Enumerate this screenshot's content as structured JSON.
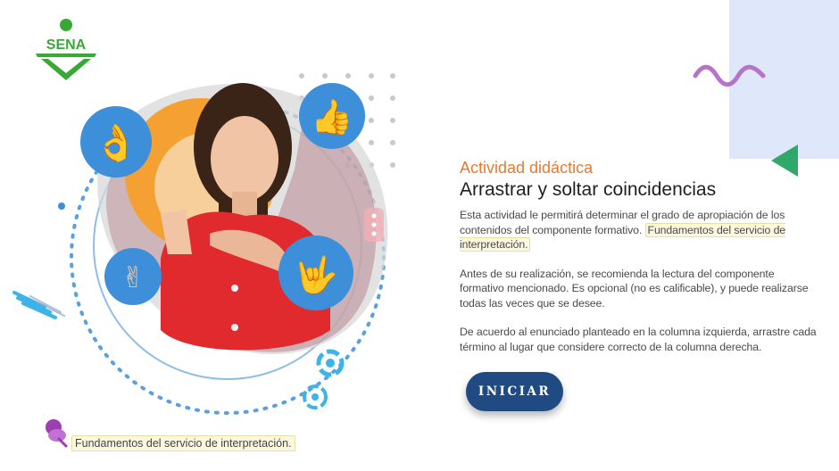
{
  "brand": {
    "logo_text": "SENA",
    "color": "#39a935"
  },
  "colors": {
    "accent": "#e57a31",
    "button": "#1f4a82",
    "bubble": "#3d8fd9",
    "squiggle": "#b574c8",
    "triangle": "#2fa96a",
    "highlight": "#fbf8de"
  },
  "activity": {
    "eyebrow": "Actividad didáctica",
    "title": "Arrastrar y soltar coincidencias",
    "p1_text": "Esta actividad le permitirá determinar el grado de apropiación de los contenidos del componente formativo. ",
    "p1_highlight": "Fundamentos del servicio de interpretación.",
    "p2": "Antes de su realización, se recomienda la lectura del componente formativo mencionado.  Es opcional (no es calificable), y puede realizarse todas las veces que se desee.",
    "p3": "De acuerdo al enunciado planteado en la columna izquierda, arrastre cada término al lugar que considere correcto de la columna derecha."
  },
  "button": {
    "label": "INICIAR"
  },
  "footer": {
    "label": "Fundamentos del servicio de interpretación.",
    "icon": "push-pin-icon"
  },
  "icons": [
    "ok-hand-icon",
    "thumbs-up-icon",
    "peace-hand-icon",
    "love-hand-icon"
  ]
}
